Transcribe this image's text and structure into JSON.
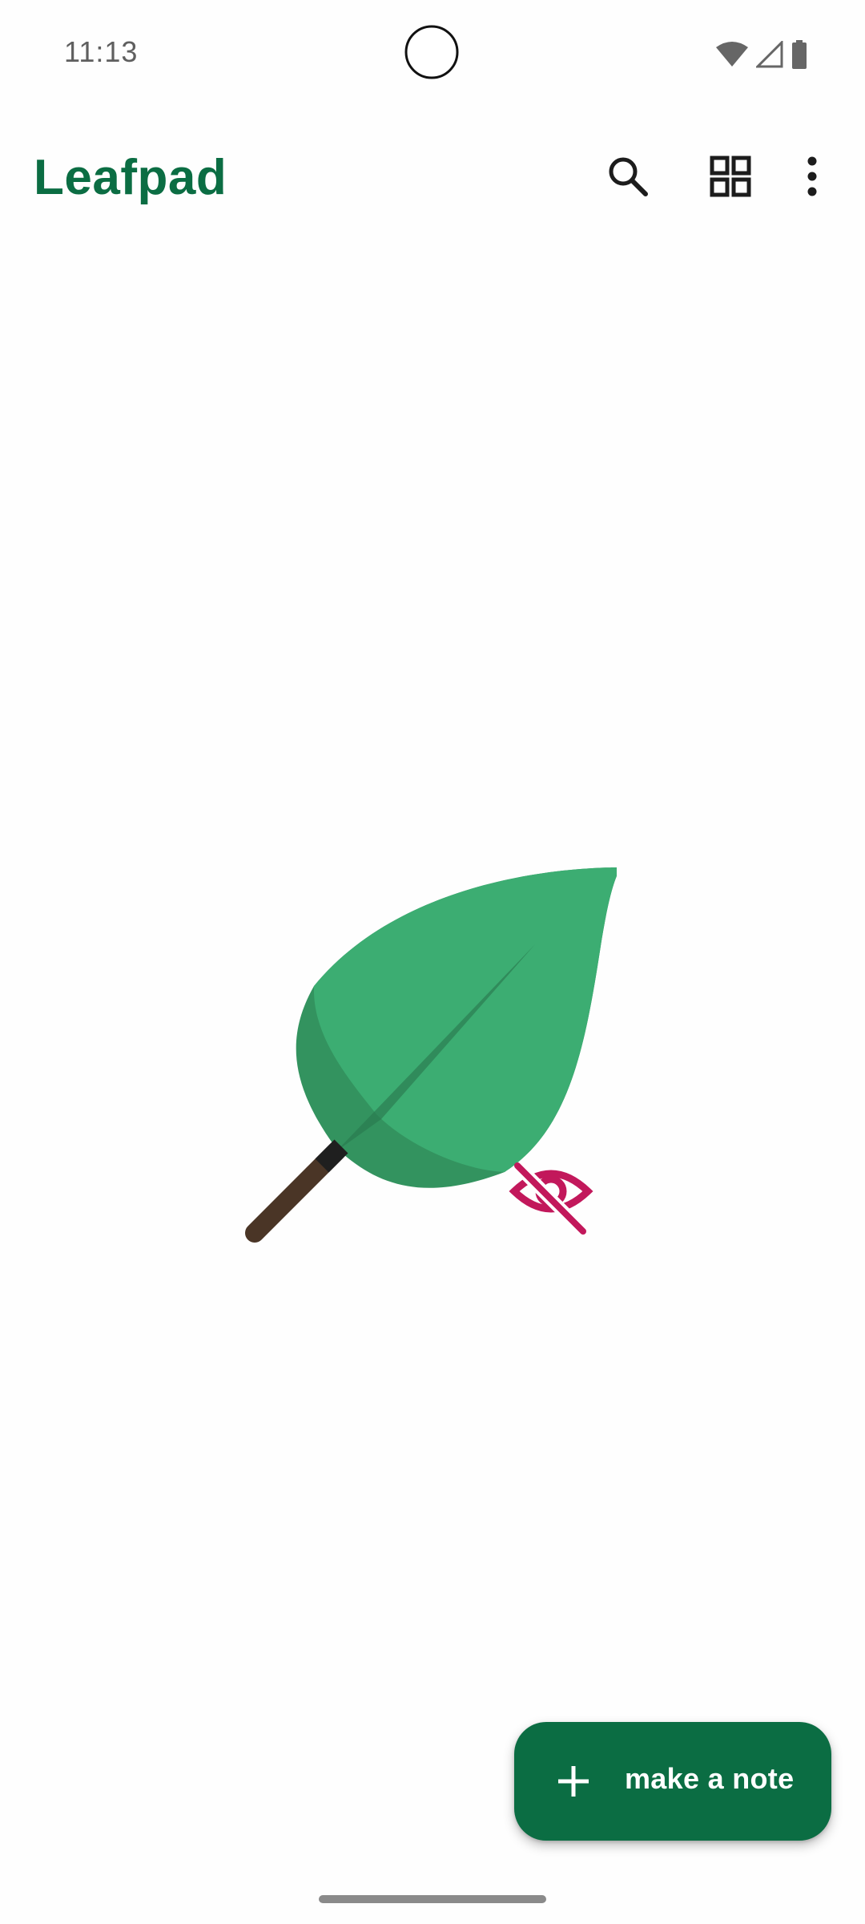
{
  "status_bar": {
    "time": "11:13",
    "icons": [
      "wifi-icon",
      "cell-signal-icon",
      "battery-icon"
    ]
  },
  "app_bar": {
    "title": "Leafpad",
    "actions": [
      "search-icon",
      "grid-view-icon",
      "more-vert-icon"
    ]
  },
  "empty_state": {
    "illustration": "leaf-with-hidden-eye-icon"
  },
  "fab": {
    "icon": "plus-icon",
    "label": "make a note"
  },
  "colors": {
    "brand_green": "#0b6d43",
    "leaf_light": "#3cad72",
    "leaf_dark": "#33935f",
    "stem": "#4a3526",
    "eye_off": "#c2185b"
  }
}
